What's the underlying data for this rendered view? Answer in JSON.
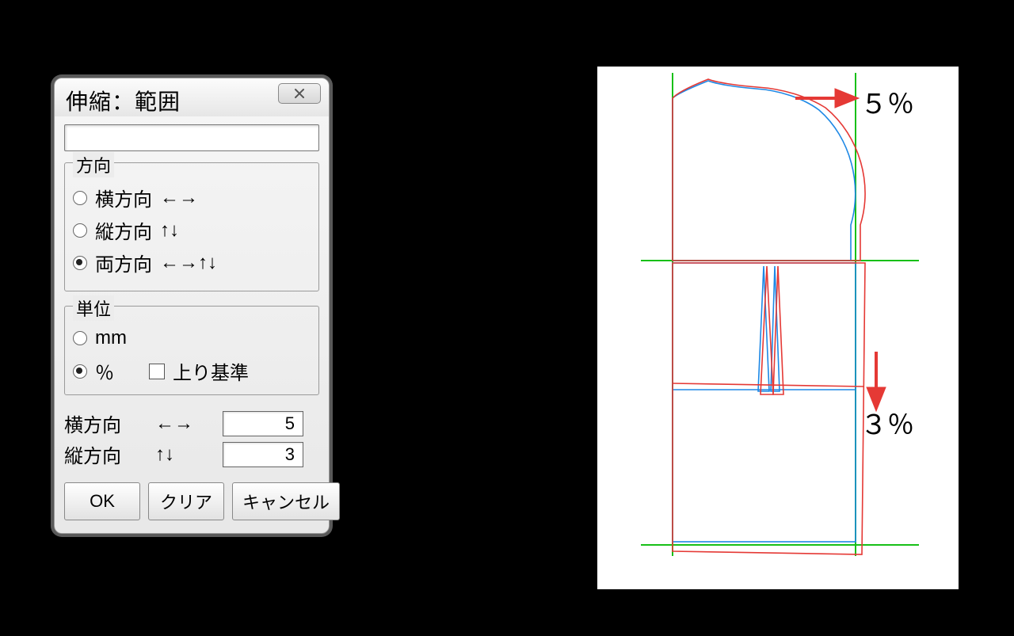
{
  "dialog": {
    "title": "伸縮：範囲",
    "top_value": "",
    "direction_group": {
      "legend": "方向",
      "options": [
        {
          "label": "横方向",
          "arrows": "←→",
          "selected": false
        },
        {
          "label": "縦方向",
          "arrows": "↑↓",
          "selected": false
        },
        {
          "label": "両方向",
          "arrows": "←→↑↓",
          "selected": true
        }
      ]
    },
    "unit_group": {
      "legend": "単位",
      "option_mm": {
        "label": "mm",
        "selected": false
      },
      "option_percent": {
        "label": "％",
        "selected": true
      },
      "agari_checkbox": {
        "label": "上り基準",
        "checked": false
      }
    },
    "values": {
      "horizontal": {
        "label": "横方向",
        "arrows": "←→",
        "value": "5"
      },
      "vertical": {
        "label": "縦方向",
        "arrows": "↑↓",
        "value": "3"
      }
    },
    "buttons": {
      "ok": "OK",
      "clear": "クリア",
      "cancel": "キャンセル"
    }
  },
  "preview": {
    "annotation_horizontal": "５％",
    "annotation_vertical": "３％"
  }
}
